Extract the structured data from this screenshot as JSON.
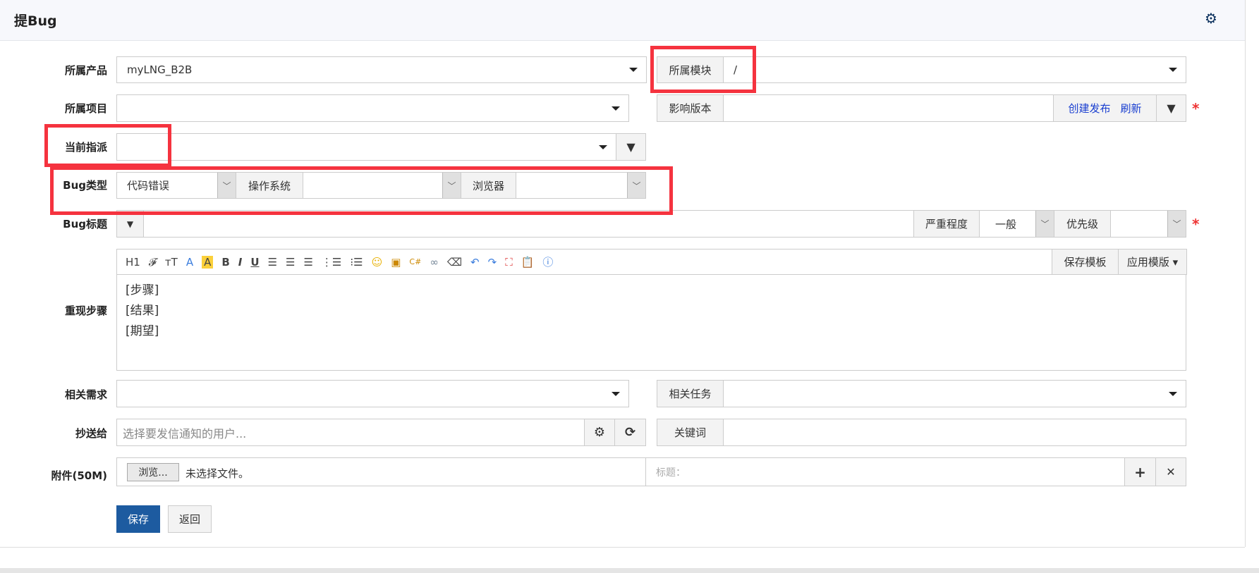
{
  "header": {
    "title": "提Bug",
    "settings_icon": "gear-icon"
  },
  "form": {
    "product": {
      "label": "所属产品",
      "value": "myLNG_B2B"
    },
    "module": {
      "label": "所属模块",
      "value": "/"
    },
    "project": {
      "label": "所属项目",
      "value": ""
    },
    "build": {
      "label": "影响版本",
      "create_release": "创建发布",
      "refresh": "刷新"
    },
    "assigned": {
      "label": "当前指派",
      "value": ""
    },
    "type": {
      "label": "Bug类型",
      "value": "代码错误",
      "os_label": "操作系统",
      "os_value": "",
      "browser_label": "浏览器",
      "browser_value": ""
    },
    "title": {
      "label": "Bug标题",
      "value": "",
      "severity_label": "严重程度",
      "severity_value": "一般",
      "priority_label": "优先级",
      "priority_value": ""
    },
    "steps": {
      "label": "重现步骤",
      "lines": [
        "[步骤]",
        "[结果]",
        "[期望]"
      ],
      "save_template": "保存模板",
      "apply_template": "应用模版"
    },
    "story": {
      "label": "相关需求",
      "value": ""
    },
    "task": {
      "label": "相关任务",
      "value": ""
    },
    "mailto": {
      "label": "抄送给",
      "placeholder": "选择要发信通知的用户..."
    },
    "keywords": {
      "label": "关键词",
      "value": ""
    },
    "files": {
      "label": "附件(50M)",
      "browse": "浏览...",
      "no_file": "未选择文件。",
      "title_placeholder": "标题："
    },
    "required_mark": "*",
    "save": "保存",
    "back": "返回"
  },
  "toolbar": {
    "heading": "H1",
    "font": "𝓕",
    "size": "тT",
    "bold": "B",
    "italic": "I",
    "underline": "U"
  },
  "colors": {
    "accent": "#1d5ba0",
    "highlight": "#f5333f"
  }
}
